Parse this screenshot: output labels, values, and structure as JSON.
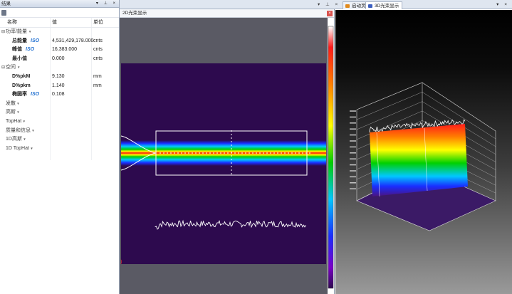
{
  "left_panel": {
    "title": "结果",
    "columns": {
      "name": "名称",
      "value": "值",
      "unit": "单位"
    },
    "power_group": {
      "label": "功率/能量"
    },
    "power_rows": [
      {
        "name": "总能量",
        "iso": "ISO",
        "value": "4,531,429,178.000",
        "unit": "cnts"
      },
      {
        "name": "峰值",
        "iso": "ISO",
        "value": "16,383.000",
        "unit": "cnts"
      },
      {
        "name": "最小值",
        "iso": "",
        "value": "0.000",
        "unit": "cnts"
      }
    ],
    "space_group": {
      "label": "空间"
    },
    "space_rows": [
      {
        "name": "D%pkM",
        "iso": "",
        "value": "9.130",
        "unit": "mm"
      },
      {
        "name": "D%pkm",
        "iso": "",
        "value": "1.140",
        "unit": "mm"
      },
      {
        "name": "椭圆率",
        "iso": "ISO",
        "value": "0.108",
        "unit": ""
      }
    ],
    "other_groups": [
      "发散",
      "高斯",
      "TopHat",
      "质量和信息",
      "1D高斯",
      "1D TopHat"
    ]
  },
  "view2d": {
    "title": "2D光束显示",
    "close_glyph": "×",
    "colors": {
      "background": "#2d0a4e",
      "frame": "#5a5a64",
      "box": "#ffffff",
      "colorbar": [
        "#ffffff",
        "#ff1a1a",
        "#ff7f00",
        "#ffff00",
        "#00d000",
        "#00c8ff",
        "#1a2dff",
        "#7a00c8",
        "#2d0a4e"
      ]
    }
  },
  "tabs": [
    {
      "label": "启动页",
      "active": false,
      "icon": "home-icon"
    },
    {
      "label": "3D光束显示",
      "active": true,
      "icon": "cube-icon"
    }
  ],
  "title_controls": {
    "pin": "▾ ⊥ ×",
    "right": "▾ ×"
  },
  "icons": {
    "toolbar": "results-icon",
    "collapse": "minus-box-icon"
  }
}
